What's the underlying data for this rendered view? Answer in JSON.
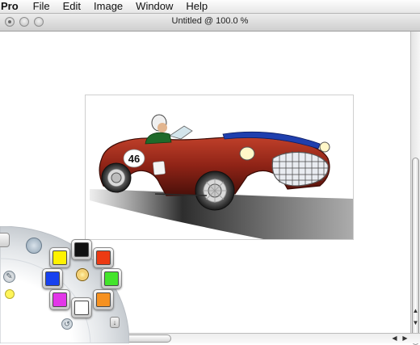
{
  "menubar": {
    "app": "Pro",
    "items": [
      "File",
      "Edit",
      "Image",
      "Window",
      "Help"
    ]
  },
  "window": {
    "title": "Untitled @ 100.0 %"
  },
  "canvas": {
    "car_number": "46"
  },
  "palette": {
    "colors": {
      "black": "#111111",
      "yellow": "#fff200",
      "red": "#ec3a13",
      "blue": "#1741ef",
      "green": "#43e42b",
      "magenta": "#e236e8",
      "white": "#ffffff",
      "orange": "#f69120",
      "center": "#e6a416",
      "side_dot": "#fff55a"
    },
    "icons": [
      "panel-toggle-icon",
      "brush-tool-icon",
      "swap-icon",
      "eyedropper-icon",
      "mode-icon"
    ]
  },
  "scrollbars": {
    "vertical_arrows": [
      "▲",
      "▼"
    ],
    "horizontal_arrows": [
      "◀",
      "▶"
    ]
  }
}
